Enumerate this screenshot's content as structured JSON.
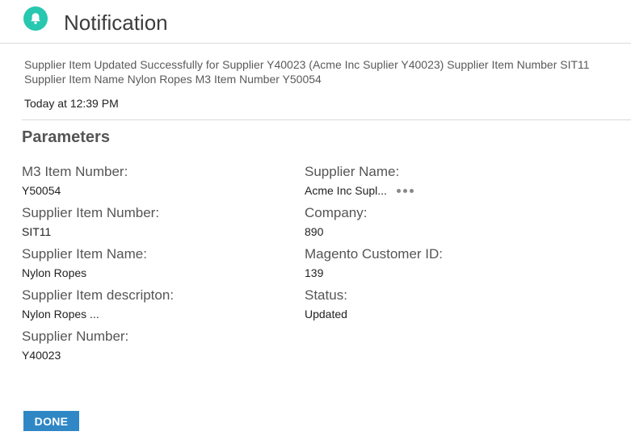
{
  "header": {
    "title": "Notification",
    "icon": "bell-icon",
    "accent_color": "#28c7b0"
  },
  "message": {
    "line1": "Supplier Item Updated Successfully for Supplier Y40023 (Acme Inc Suplier Y40023) Supplier Item Number SIT11",
    "line2": "Supplier Item Name Nylon Ropes M3 Item Number Y50054"
  },
  "timestamp": "Today at 12:39 PM",
  "parameters": {
    "title": "Parameters",
    "left": [
      {
        "label": "M3 Item Number:",
        "value": "Y50054"
      },
      {
        "label": "Supplier Item Number:",
        "value": "SIT11"
      },
      {
        "label": "Supplier Item Name:",
        "value": "Nylon Ropes"
      },
      {
        "label": "Supplier Item descripton:",
        "value": "Nylon Ropes ..."
      },
      {
        "label": "Supplier Number:",
        "value": "Y40023"
      }
    ],
    "right": [
      {
        "label": "Supplier Name:",
        "value": "Acme Inc Supl..."
      },
      {
        "label": "Company:",
        "value": "890"
      },
      {
        "label": "Magento Customer ID:",
        "value": "139"
      },
      {
        "label": "Status:",
        "value": "Updated"
      }
    ]
  },
  "actions": {
    "done_label": "DONE",
    "done_color": "#2f87c5"
  }
}
